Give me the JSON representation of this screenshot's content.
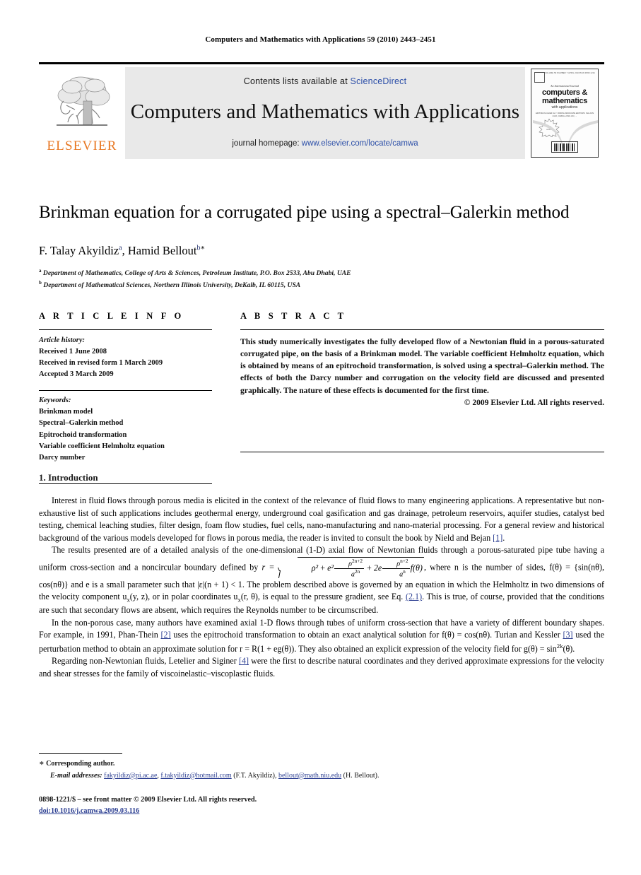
{
  "running_head": "Computers and Mathematics with Applications 59 (2010) 2443–2451",
  "masthead": {
    "contents_prefix": "Contents lists available at ",
    "sciencedirect": "ScienceDirect",
    "journal_title": "Computers and Mathematics with Applications",
    "homepage_prefix": "journal homepage: ",
    "homepage_url": "www.elsevier.com/locate/camwa",
    "publisher_logo_text": "ELSEVIER",
    "logo_color": "#e87722",
    "link_color": "#2c4fa8",
    "panel_bg": "#e9e9e9",
    "cover": {
      "top_left_label": "ELSEVIER",
      "top_center_label": "VOLUME 59   NUMBER 7   APRIL 2010",
      "top_right_label": "ISSN 0898-1221",
      "subtitle": "An International Journal",
      "title_line1": "computers &",
      "title_line2": "mathematics",
      "title_line3": "with applications",
      "editors": "EDITOR-IN-CHIEF: E.Y. RODIN\nASSOCIATE EDITORS: SHI-JUN LIAO, CHING-LUNG LIN, ...",
      "burst_text": "Now available online at ScienceDirect",
      "barcode_text": "0898-1221"
    }
  },
  "article": {
    "title": "Brinkman equation for a corrugated pipe using a spectral–Galerkin method",
    "authors": [
      {
        "name": "F. Talay Akyildiz",
        "marks": "a"
      },
      {
        "name": "Hamid Bellout",
        "marks": "b"
      }
    ],
    "authors_separator": ", ",
    "corresponding_mark": "∗",
    "affiliations": [
      {
        "mark": "a",
        "text": "Department of Mathematics, College of Arts & Sciences, Petroleum Institute, P.O. Box 2533, Abu Dhabi, UAE"
      },
      {
        "mark": "b",
        "text": "Department of Mathematical Sciences, Northern Illinois University, DeKalb, IL 60115, USA"
      }
    ]
  },
  "article_info": {
    "heading": "A R T I C L E    I N F O",
    "history_label": "Article history:",
    "history": [
      "Received 1 June 2008",
      "Received in revised form 1 March 2009",
      "Accepted 3 March 2009"
    ],
    "keywords_label": "Keywords:",
    "keywords": [
      "Brinkman model",
      "Spectral–Galerkin method",
      "Epitrochoid transformation",
      "Variable coefficient Helmholtz equation",
      "Darcy number"
    ]
  },
  "abstract": {
    "heading": "A B S T R A C T",
    "text": "This study numerically investigates the fully developed flow of a Newtonian fluid in a porous-saturated corrugated pipe, on the basis of a Brinkman model. The variable coefficient Helmholtz equation, which is obtained by means of an epitrochoid transformation, is solved using a spectral–Galerkin method. The effects of both the Darcy number and corrugation on the velocity field are discussed and presented graphically. The nature of these effects is documented for the first time.",
    "copyright": "© 2009 Elsevier Ltd. All rights reserved."
  },
  "introduction": {
    "heading": "1. Introduction",
    "paragraph_1": "Interest in fluid flows through porous media is elicited in the context of the relevance of fluid flows to many engineering applications. A representative but non-exhaustive list of such applications includes geothermal energy, underground coal gasification and gas drainage, petroleum reservoirs, aquifer studies, catalyst bed testing, chemical leaching studies, filter design, foam flow studies, fuel cells, nano-manufacturing and nano-material processing. For a general review and historical background of the various models developed for flows in porous media, the reader is invited to consult the book by Nield and Bejan ",
    "paragraph_1_ref": "[1]",
    "paragraph_1_end": ".",
    "paragraph_2_a": "The results presented are of a detailed analysis of the one-dimensional (1-D) axial flow of Newtonian fluids through a porous-saturated pipe tube having a uniform cross-section and a noncircular boundary defined by ",
    "paragraph_2_eq_lead": "r  =",
    "formula": {
      "rho_sq": "ρ²",
      "plus1": " + ",
      "e_sq": "e²",
      "frac1_num": "ρ",
      "frac1_num_sup": "2n+2",
      "frac1_den": "a",
      "frac1_den_sup": "2n",
      "plus2": " + ",
      "two_e": "2e",
      "frac2_num": "ρ",
      "frac2_num_sup": "n+2",
      "frac2_den": "a",
      "frac2_den_sup": "n",
      "f_theta": "f(θ)"
    },
    "paragraph_2_b": ", where n is the number of sides, f(θ) = {sin(nθ), cos(nθ)} and e is a small parameter such that |ε|(n + 1) < 1. The problem described above is governed by an equation in which the Helmholtz in two dimensions of the velocity component u",
    "paragraph_2_sub1": "x",
    "paragraph_2_c": "(y, z), or in polar coordinates u",
    "paragraph_2_sub2": "x",
    "paragraph_2_d": "(r, θ), is equal to the pressure gradient, see Eq. ",
    "paragraph_2_ref": "(2.1)",
    "paragraph_2_e": ". This is true, of course, provided that the conditions are such that secondary flows are absent, which requires the Reynolds number to be circumscribed.",
    "paragraph_3_a": "In the non-porous case, many authors have examined axial 1-D flows through tubes of uniform cross-section that have a variety of different boundary shapes. For example, in 1991, Phan-Thein ",
    "paragraph_3_ref1": "[2]",
    "paragraph_3_b": " uses the epitrochoid transformation to obtain an exact analytical solution for f(θ) = cos(nθ). Turian and Kessler ",
    "paragraph_3_ref2": "[3]",
    "paragraph_3_c": " used the perturbation method to obtain an approximate solution for r = R(1 + eg(θ)). They also obtained an explicit expression of the velocity field for g(θ) = sin",
    "paragraph_3_sup": "2k",
    "paragraph_3_d": "(θ).",
    "paragraph_4_a": "Regarding non-Newtonian fluids, Letelier and Siginer ",
    "paragraph_4_ref": "[4]",
    "paragraph_4_b": " were the first to describe natural coordinates and they derived approximate expressions for the velocity and shear stresses for the family of viscoinelastic–viscoplastic fluids."
  },
  "footnote": {
    "star": "∗",
    "corresponding": "Corresponding author.",
    "email_label": "E-mail addresses:",
    "emails": [
      {
        "address": "fakyildiz@pi.ac.ae",
        "owner": ""
      },
      {
        "address": "f.takyildiz@hotmail.com",
        "owner": "(F.T. Akyildiz)"
      },
      {
        "address": "bellout@math.niu.edu",
        "owner": "(H. Bellout)"
      }
    ]
  },
  "imprint": {
    "line1": "0898-1221/$ – see front matter © 2009 Elsevier Ltd. All rights reserved.",
    "doi": "doi:10.1016/j.camwa.2009.03.116"
  }
}
